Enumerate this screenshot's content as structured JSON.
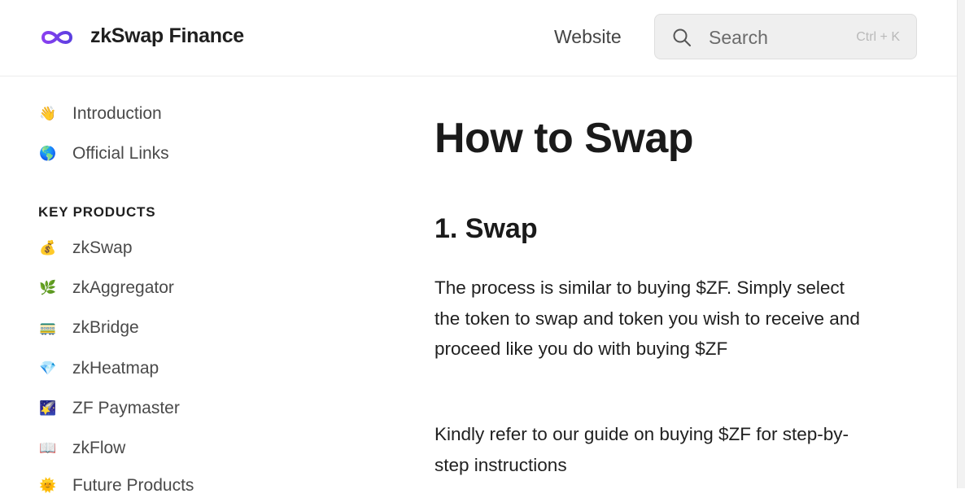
{
  "header": {
    "brand": "zkSwap Finance",
    "nav_website": "Website",
    "search": {
      "label": "Search",
      "shortcut": "Ctrl + K"
    },
    "logo_color": "#7b3fe4"
  },
  "sidebar": {
    "top_items": [
      {
        "emoji": "👋",
        "label": "Introduction"
      },
      {
        "emoji": "🌎",
        "label": "Official Links"
      }
    ],
    "section_title": "KEY PRODUCTS",
    "product_items": [
      {
        "emoji": "💰",
        "label": "zkSwap"
      },
      {
        "emoji": "🌿",
        "label": "zkAggregator"
      },
      {
        "emoji": "🚃",
        "label": "zkBridge"
      },
      {
        "emoji": "💎",
        "label": "zkHeatmap"
      },
      {
        "emoji": "🌠",
        "label": "ZF Paymaster"
      },
      {
        "emoji": "📖",
        "label": "zkFlow"
      },
      {
        "emoji": "🌞",
        "label": "Future Products"
      }
    ]
  },
  "main": {
    "title": "How to Swap",
    "section_heading": "1. Swap",
    "paragraph1": "The process is similar to buying $ZF. Simply select the token to swap and token you wish to receive and proceed like you do with buying $ZF",
    "paragraph2": "Kindly refer to our guide on buying $ZF for step-by-step instructions"
  }
}
